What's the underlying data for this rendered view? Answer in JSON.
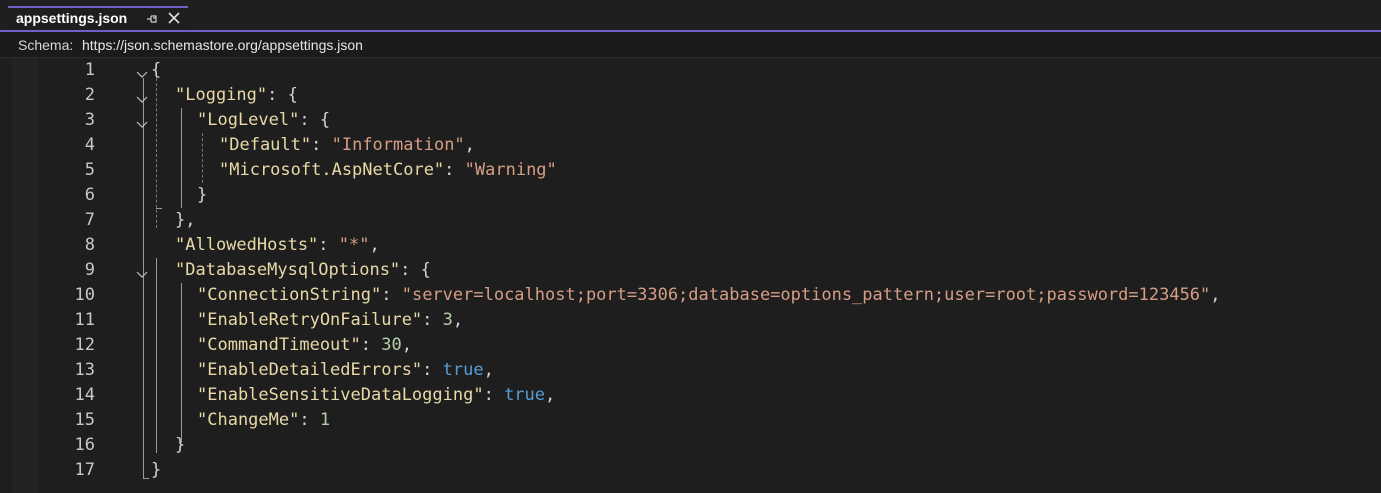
{
  "tab": {
    "title": "appsettings.json",
    "pin_icon": "pin-icon",
    "close_icon": "close-icon"
  },
  "schema": {
    "label": "Schema:",
    "value": "https://json.schemastore.org/appsettings.json"
  },
  "colors": {
    "accent": "#6f5fc7",
    "key": "#e8d9a6",
    "string": "#d69d85",
    "number": "#b5cea8",
    "keyword": "#569cd6",
    "punct": "#d4d4d4"
  },
  "editor": {
    "line_numbers": [
      "1",
      "2",
      "3",
      "4",
      "5",
      "6",
      "7",
      "8",
      "9",
      "10",
      "11",
      "12",
      "13",
      "14",
      "15",
      "16",
      "17"
    ],
    "lines": {
      "l1": {
        "p1": "{"
      },
      "l2": {
        "key": "\"Logging\"",
        "p1": ": {"
      },
      "l3": {
        "key": "\"LogLevel\"",
        "p1": ": {"
      },
      "l4": {
        "key": "\"Default\"",
        "p1": ": ",
        "val": "\"Information\"",
        "p2": ","
      },
      "l5": {
        "key": "\"Microsoft.AspNetCore\"",
        "p1": ": ",
        "val": "\"Warning\""
      },
      "l6": {
        "p1": "}"
      },
      "l7": {
        "p1": "},"
      },
      "l8": {
        "key": "\"AllowedHosts\"",
        "p1": ": ",
        "val": "\"*\"",
        "p2": ","
      },
      "l9": {
        "key": "\"DatabaseMysqlOptions\"",
        "p1": ": {"
      },
      "l10": {
        "key": "\"ConnectionString\"",
        "p1": ": ",
        "val": "\"server=localhost;port=3306;database=options_pattern;user=root;password=123456\"",
        "p2": ","
      },
      "l11": {
        "key": "\"EnableRetryOnFailure\"",
        "p1": ": ",
        "val": "3",
        "p2": ","
      },
      "l12": {
        "key": "\"CommandTimeout\"",
        "p1": ": ",
        "val": "30",
        "p2": ","
      },
      "l13": {
        "key": "\"EnableDetailedErrors\"",
        "p1": ": ",
        "val": "true",
        "p2": ","
      },
      "l14": {
        "key": "\"EnableSensitiveDataLogging\"",
        "p1": ": ",
        "val": "true",
        "p2": ","
      },
      "l15": {
        "key": "\"ChangeMe\"",
        "p1": ": ",
        "val": "1"
      },
      "l16": {
        "p1": "}"
      },
      "l17": {
        "p1": "}"
      }
    }
  }
}
